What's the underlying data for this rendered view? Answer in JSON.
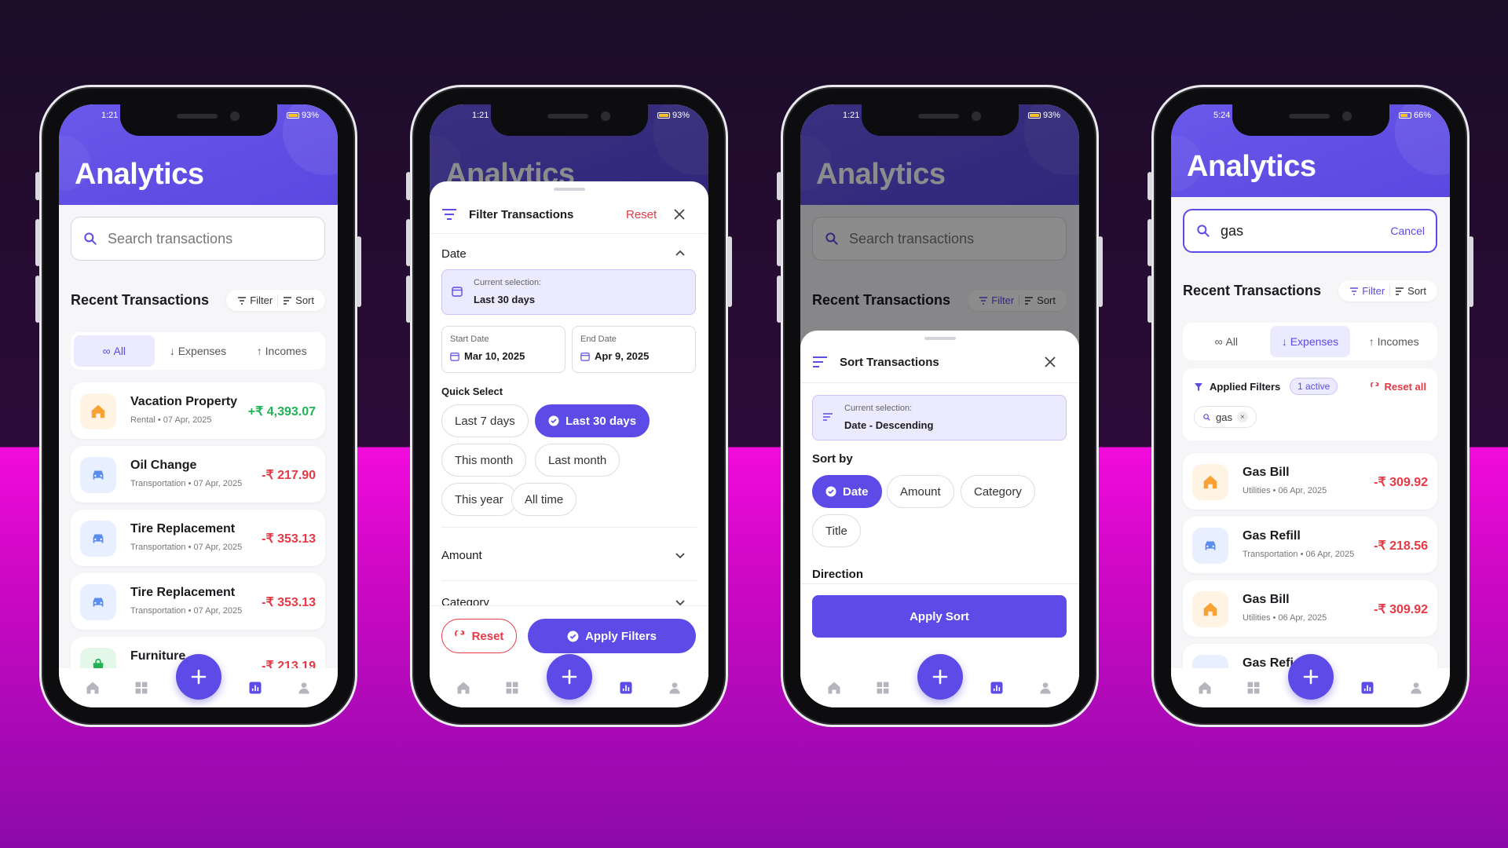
{
  "screen1": {
    "status": {
      "time": "1:21",
      "battery": "93%"
    },
    "title": "Analytics",
    "search_placeholder": "Search transactions",
    "section_title": "Recent Transactions",
    "filter_label": "Filter",
    "sort_label": "Sort",
    "tabs": [
      "All",
      "Expenses",
      "Incomes"
    ],
    "transactions": [
      {
        "name": "Vacation Property",
        "meta": "Rental • 07 Apr, 2025",
        "amount": "+₹ 4,393.07",
        "icon": "home-icon"
      },
      {
        "name": "Oil Change",
        "meta": "Transportation • 07 Apr, 2025",
        "amount": "-₹ 217.90",
        "icon": "car-icon"
      },
      {
        "name": "Tire Replacement",
        "meta": "Transportation • 07 Apr, 2025",
        "amount": "-₹ 353.13",
        "icon": "car-icon"
      },
      {
        "name": "Tire Replacement",
        "meta": "Transportation • 07 Apr, 2025",
        "amount": "-₹ 353.13",
        "icon": "car-icon"
      },
      {
        "name": "Furniture",
        "meta": "",
        "amount": "-₹ 213.19",
        "icon": "bag-icon"
      }
    ]
  },
  "screen2": {
    "status": {
      "time": "1:21",
      "battery": "93%"
    },
    "title": "Analytics",
    "sheet_title": "Filter Transactions",
    "reset_link": "Reset",
    "date_section": "Date",
    "current_selection_label": "Current selection:",
    "current_selection_value": "Last 30 days",
    "start_date_label": "Start Date",
    "start_date_value": "Mar 10, 2025",
    "end_date_label": "End Date",
    "end_date_value": "Apr 9, 2025",
    "quick_select_label": "Quick Select",
    "quick_options": [
      "Last 7 days",
      "Last 30 days",
      "This month",
      "Last month",
      "This year",
      "All time"
    ],
    "amount_section": "Amount",
    "category_section": "Category",
    "reset_button": "Reset",
    "apply_button": "Apply Filters"
  },
  "screen3": {
    "status": {
      "time": "1:21",
      "battery": "93%"
    },
    "title": "Analytics",
    "search_placeholder": "Search transactions",
    "section_title": "Recent Transactions",
    "filter_label": "Filter",
    "sort_label": "Sort",
    "sheet_title": "Sort Transactions",
    "current_selection_label": "Current selection:",
    "current_selection_value": "Date - Descending",
    "sort_by_label": "Sort by",
    "sort_options": [
      "Date",
      "Amount",
      "Category",
      "Title"
    ],
    "direction_label": "Direction",
    "apply_button": "Apply Sort"
  },
  "screen4": {
    "status": {
      "time": "5:24",
      "battery": "66%"
    },
    "title": "Analytics",
    "search_value": "gas",
    "cancel_label": "Cancel",
    "section_title": "Recent Transactions",
    "filter_label": "Filter",
    "sort_label": "Sort",
    "tabs": [
      "All",
      "Expenses",
      "Incomes"
    ],
    "applied_filters_label": "Applied Filters",
    "active_badge": "1 active",
    "reset_all": "Reset all",
    "filter_chip": "gas",
    "transactions": [
      {
        "name": "Gas Bill",
        "meta": "Utilities • 06 Apr, 2025",
        "amount": "-₹ 309.92",
        "icon": "home-icon"
      },
      {
        "name": "Gas Refill",
        "meta": "Transportation • 06 Apr, 2025",
        "amount": "-₹ 218.56",
        "icon": "car-icon"
      },
      {
        "name": "Gas Bill",
        "meta": "Utilities • 06 Apr, 2025",
        "amount": "-₹ 309.92",
        "icon": "home-icon"
      },
      {
        "name": "Gas Refi",
        "meta": "",
        "amount": "",
        "icon": "car-icon"
      }
    ]
  },
  "colors": {
    "accent": "#5c4be6",
    "expense": "#e53945",
    "income": "#22b157"
  }
}
